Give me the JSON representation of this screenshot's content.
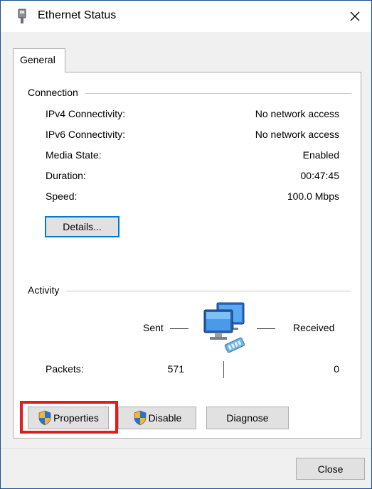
{
  "window": {
    "title": "Ethernet Status",
    "close_glyph": "✕"
  },
  "tabs": [
    {
      "label": "General"
    }
  ],
  "connection": {
    "heading": "Connection",
    "rows": [
      {
        "label": "IPv4 Connectivity:",
        "value": "No network access"
      },
      {
        "label": "IPv6 Connectivity:",
        "value": "No network access"
      },
      {
        "label": "Media State:",
        "value": "Enabled"
      },
      {
        "label": "Duration:",
        "value": "00:47:45"
      },
      {
        "label": "Speed:",
        "value": "100.0 Mbps"
      }
    ],
    "details_button": "Details..."
  },
  "activity": {
    "heading": "Activity",
    "sent_label": "Sent",
    "received_label": "Received",
    "packets_label": "Packets:",
    "packets_sent": "571",
    "packets_received": "0",
    "icon": "network-computers-icon"
  },
  "buttons": {
    "properties": "Properties",
    "disable": "Disable",
    "diagnose": "Diagnose",
    "close": "Close"
  },
  "colors": {
    "highlight": "#e31b1b",
    "window_border": "#1a4f8a",
    "focus_blue": "#0078d7"
  }
}
